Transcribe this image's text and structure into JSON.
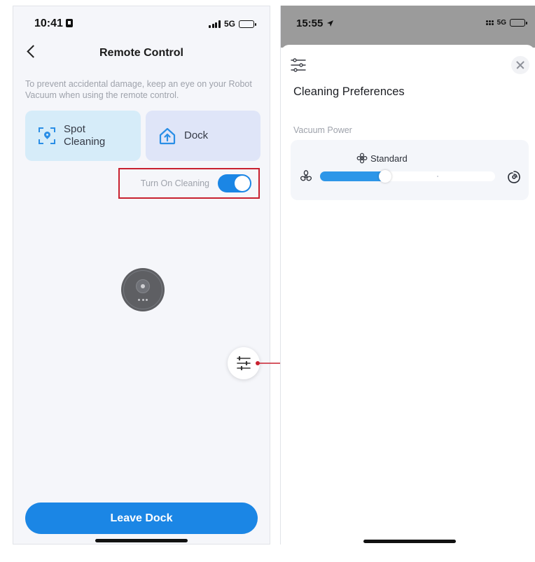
{
  "left": {
    "status": {
      "time": "10:41",
      "network": "5G"
    },
    "nav": {
      "title": "Remote Control"
    },
    "notice": "To prevent accidental damage, keep an eye on your Robot Vacuum when using the remote control.",
    "cards": [
      {
        "label": "Spot Cleaning",
        "icon": "spot-cleaning-icon"
      },
      {
        "label": "Dock",
        "icon": "dock-home-icon"
      }
    ],
    "toggle": {
      "label": "Turn On Cleaning",
      "on": true
    },
    "leave_button": "Leave Dock"
  },
  "right": {
    "status": {
      "time": "15:55",
      "network": "5G"
    },
    "heading": "Cleaning Preferences",
    "section_label": "Vacuum Power",
    "power": {
      "level_label": "Standard",
      "level_fraction": 0.35
    }
  },
  "colors": {
    "accent": "#1b86e5",
    "highlight_border": "#c8202f"
  }
}
